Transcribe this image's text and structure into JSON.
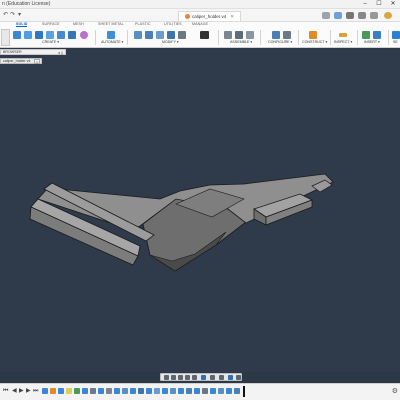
{
  "window": {
    "app_title": "n (Education License)",
    "controls": [
      "–",
      "☐",
      "✕"
    ]
  },
  "tabbar": {
    "doc_tab": "caliper_holder v4",
    "doc_close": "✕"
  },
  "ribbon": {
    "workspace_tabs": [
      "SOLID",
      "SURFACE",
      "MESH",
      "SHEET METAL",
      "PLASTIC",
      "UTILITIES",
      "MANAGE"
    ],
    "active_tab": "SOLID",
    "groups": [
      {
        "label": "CREATE ▾"
      },
      {
        "label": "AUTOMATE ▾"
      },
      {
        "label": "MODIFY ▾"
      },
      {
        "label": "ASSEMBLE ▾"
      },
      {
        "label": "CONFIGURE ▾"
      },
      {
        "label": "CONSTRUCT ▾"
      },
      {
        "label": "INSPECT ▾"
      },
      {
        "label": "INSERT ▾"
      },
      {
        "label": "SE"
      }
    ],
    "design_label": "DESIGN"
  },
  "browser": {
    "title": "BROWSER",
    "grip": "◂ ||"
  },
  "comment_strip": {
    "label": "caliper_holder v4",
    "button": "◎"
  },
  "colors": {
    "viewport_bg": "#2f3b4a",
    "model_face": "#8e8e8e",
    "model_edge": "#1a1a1a",
    "accent": "#0a5fbf"
  },
  "timeline": {
    "controls": [
      "⏮",
      "◀",
      "▶",
      "▶",
      "⏭"
    ],
    "settings_icon": "gear-icon"
  }
}
